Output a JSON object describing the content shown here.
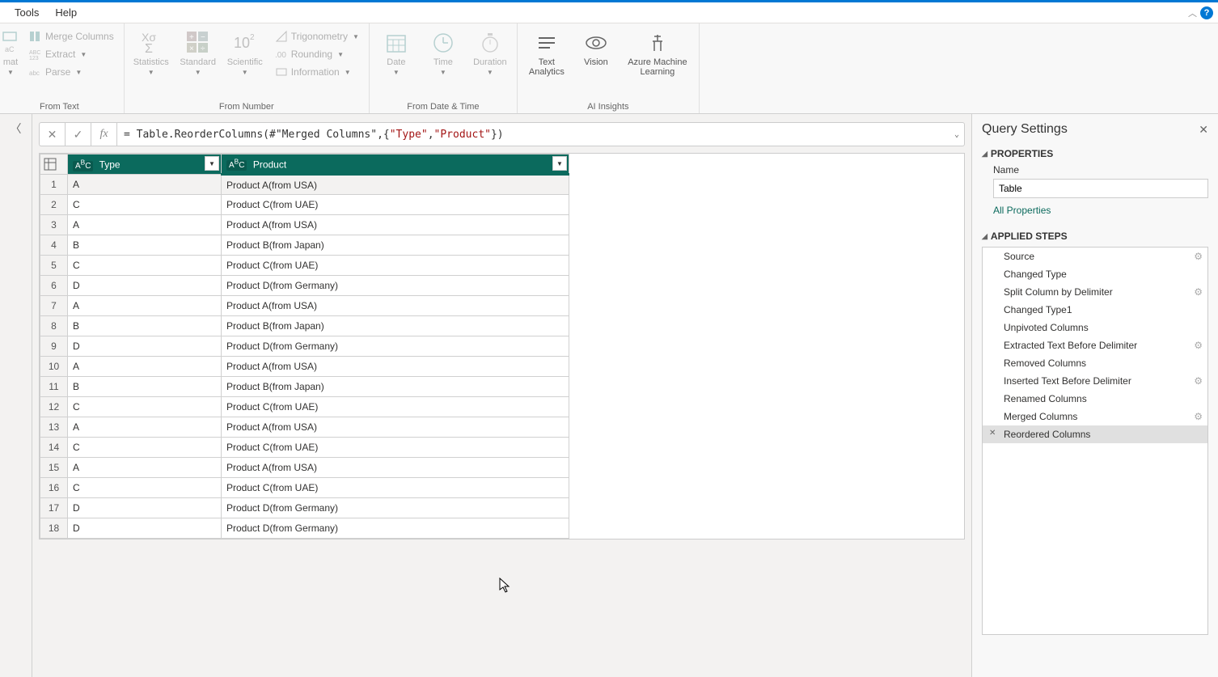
{
  "menubar": {
    "tools": "Tools",
    "help": "Help"
  },
  "ribbon": {
    "from_text": {
      "label": "From Text",
      "format": "mat",
      "merge": "Merge Columns",
      "extract": "Extract",
      "parse": "Parse"
    },
    "from_number": {
      "label": "From Number",
      "statistics": "Statistics",
      "standard": "Standard",
      "scientific": "Scientific",
      "trig": "Trigonometry",
      "rounding": "Rounding",
      "info": "Information"
    },
    "from_datetime": {
      "label": "From Date & Time",
      "date": "Date",
      "time": "Time",
      "duration": "Duration"
    },
    "ai": {
      "label": "AI Insights",
      "text_analytics": "Text\nAnalytics",
      "vision": "Vision",
      "azure_ml": "Azure Machine\nLearning"
    }
  },
  "formula": {
    "prefix": "= Table.ReorderColumns(#\"Merged Columns\",{",
    "tok1": "\"Type\"",
    "sep": ", ",
    "tok2": "\"Product\"",
    "suffix": "})"
  },
  "grid": {
    "columns": {
      "type": "Type",
      "product": "Product"
    },
    "rows": [
      {
        "n": 1,
        "type": "A",
        "product": "Product  A(from USA)"
      },
      {
        "n": 2,
        "type": "C",
        "product": "Product  C(from UAE)"
      },
      {
        "n": 3,
        "type": "A",
        "product": "Product  A(from USA)"
      },
      {
        "n": 4,
        "type": "B",
        "product": "Product  B(from Japan)"
      },
      {
        "n": 5,
        "type": "C",
        "product": "Product  C(from UAE)"
      },
      {
        "n": 6,
        "type": "D",
        "product": "Product  D(from Germany)"
      },
      {
        "n": 7,
        "type": "A",
        "product": "Product  A(from USA)"
      },
      {
        "n": 8,
        "type": "B",
        "product": "Product  B(from Japan)"
      },
      {
        "n": 9,
        "type": "D",
        "product": "Product  D(from Germany)"
      },
      {
        "n": 10,
        "type": "A",
        "product": "Product  A(from USA)"
      },
      {
        "n": 11,
        "type": "B",
        "product": "Product  B(from Japan)"
      },
      {
        "n": 12,
        "type": "C",
        "product": "Product  C(from UAE)"
      },
      {
        "n": 13,
        "type": "A",
        "product": "Product  A(from USA)"
      },
      {
        "n": 14,
        "type": "C",
        "product": "Product  C(from UAE)"
      },
      {
        "n": 15,
        "type": "A",
        "product": "Product  A(from USA)"
      },
      {
        "n": 16,
        "type": "C",
        "product": "Product  C(from UAE)"
      },
      {
        "n": 17,
        "type": "D",
        "product": "Product  D(from Germany)"
      },
      {
        "n": 18,
        "type": "D",
        "product": "Product  D(from Germany)"
      }
    ]
  },
  "query_settings": {
    "title": "Query Settings",
    "properties_head": "PROPERTIES",
    "name_label": "Name",
    "name_value": "Table",
    "all_properties": "All Properties",
    "applied_steps_head": "APPLIED STEPS",
    "steps": [
      {
        "label": "Source",
        "gear": true
      },
      {
        "label": "Changed Type",
        "gear": false
      },
      {
        "label": "Split Column by Delimiter",
        "gear": true
      },
      {
        "label": "Changed Type1",
        "gear": false
      },
      {
        "label": "Unpivoted Columns",
        "gear": false
      },
      {
        "label": "Extracted Text Before Delimiter",
        "gear": true
      },
      {
        "label": "Removed Columns",
        "gear": false
      },
      {
        "label": "Inserted Text Before Delimiter",
        "gear": true
      },
      {
        "label": "Renamed Columns",
        "gear": false
      },
      {
        "label": "Merged Columns",
        "gear": true
      },
      {
        "label": "Reordered Columns",
        "gear": false,
        "current": true
      }
    ]
  }
}
